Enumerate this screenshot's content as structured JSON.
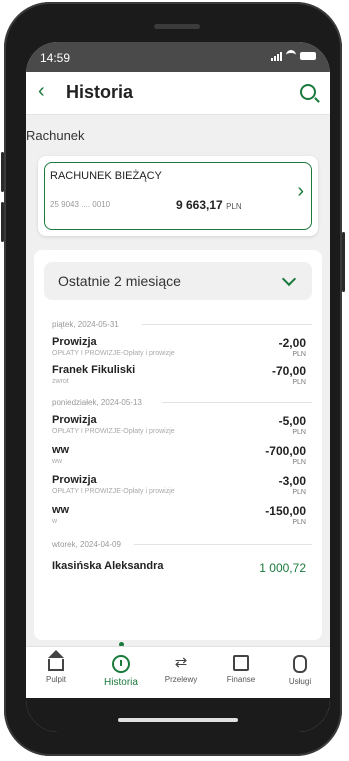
{
  "status": {
    "time": "14:59"
  },
  "header": {
    "title": "Historia"
  },
  "section": {
    "label": "Rachunek"
  },
  "account": {
    "name": "RACHUNEK BIEŻĄCY",
    "number": "25 9043 .... 0010",
    "balance": "9 663,17",
    "currency": "PLN"
  },
  "filter": {
    "label": "Ostatnie 2 miesiące"
  },
  "days": [
    {
      "label": "piątek, 2024-05-31"
    },
    {
      "label": "poniedziałek, 2024-05-13"
    },
    {
      "label": "wtorek, 2024-04-09"
    }
  ],
  "transactions": [
    {
      "title": "Prowizja",
      "sub": "OPŁATY I PROWIZJE-Opłaty i prowizje",
      "amount": "-2,00",
      "currency": "PLN"
    },
    {
      "title": "Franek Fikuliski",
      "sub": "zwrot",
      "amount": "-70,00",
      "currency": "PLN"
    },
    {
      "title": "Prowizja",
      "sub": "OPŁATY I PROWIZJE-Opłaty i prowizje",
      "amount": "-5,00",
      "currency": "PLN"
    },
    {
      "title": "ww",
      "sub": "ww",
      "amount": "-700,00",
      "currency": "PLN"
    },
    {
      "title": "Prowizja",
      "sub": "OPŁATY I PROWIZJE-Opłaty i prowizje",
      "amount": "-3,00",
      "currency": "PLN"
    },
    {
      "title": "ww",
      "sub": "w",
      "amount": "-150,00",
      "currency": "PLN"
    },
    {
      "title": "Ikasińska Aleksandra",
      "sub": "",
      "amount": "1 000,72",
      "currency": ""
    }
  ],
  "tabs": [
    {
      "label": "Pulpit",
      "icon": "home-icon"
    },
    {
      "label": "Historia",
      "icon": "history-icon",
      "active": true
    },
    {
      "label": "Przelewy",
      "icon": "transfer-icon"
    },
    {
      "label": "Finanse",
      "icon": "finance-icon"
    },
    {
      "label": "Usługi",
      "icon": "services-icon"
    }
  ],
  "colors": {
    "accent": "#1a7a3c",
    "statusbar": "#4a4a4a"
  }
}
